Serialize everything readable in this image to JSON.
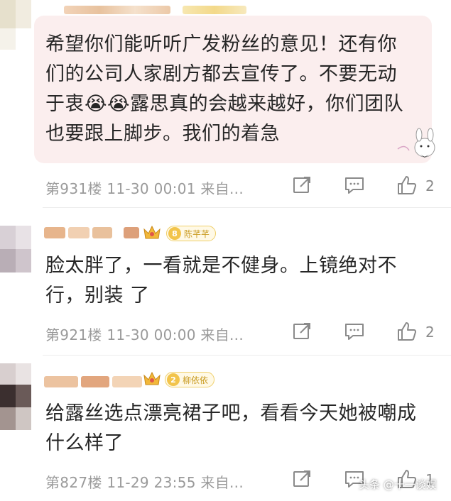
{
  "comments": [
    {
      "fan_badge": {
        "level": "",
        "name": ""
      },
      "text_lines": [
        "希望你们能听听广发粉丝的意见！还有你",
        "们的公司人家剧方都去宣传了。不要无动",
        "于衷😭😭露思真的会越来越好，你们团队",
        "也要跟上脚步。我们的着急"
      ],
      "floor": "第931楼  11-30 00:01  来自...",
      "likes": "2"
    },
    {
      "fan_badge": {
        "level": "8",
        "name": "陈芊芊"
      },
      "text_lines": [
        "脸太胖了，一看就是不健身。上镜绝对不",
        "行，别装 了"
      ],
      "floor": "第921楼  11-30 00:00  来自...",
      "likes": "2"
    },
    {
      "fan_badge": {
        "level": "2",
        "name": "柳依依"
      },
      "text_lines": [
        "给露丝选点漂亮裙子吧，看看今天她被嘲成",
        "什么样了"
      ],
      "floor": "第827楼  11-29 23:55  来自...",
      "likes": "1"
    }
  ],
  "watermark": "头条 @十一谈娱",
  "colors": {
    "bubble": "#fbeeee",
    "gray_text": "#9a9a9a",
    "gold": "#efcf6a"
  },
  "icons": [
    "share-icon",
    "reply-icon",
    "like-icon",
    "crown-icon"
  ]
}
